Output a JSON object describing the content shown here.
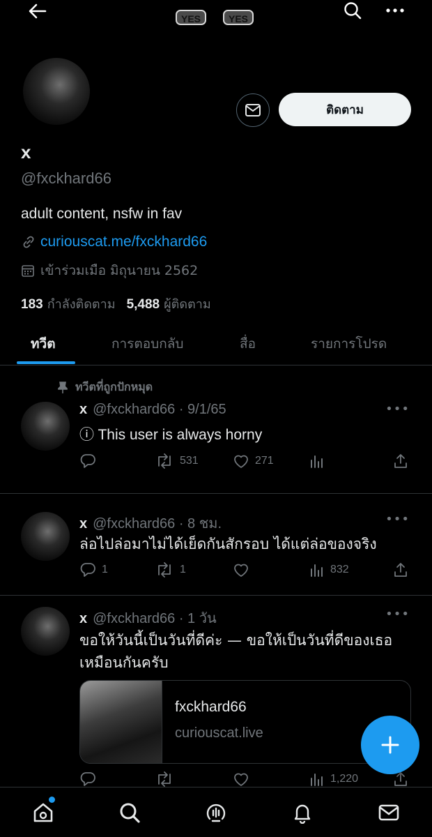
{
  "topbar": {
    "badges": [
      "YES",
      "YES"
    ]
  },
  "profile": {
    "name": "x",
    "handle": "@fxckhard66",
    "bio": "adult content, nsfw in fav",
    "link": "curiouscat.me/fxckhard66",
    "joined": "เข้าร่วมเมือ มิถุนายน 2562",
    "following_count": "183",
    "following_label": "กำลังติดตาม",
    "followers_count": "5,488",
    "followers_label": "ผู้ติดตาม",
    "follow_button": "ติดตาม"
  },
  "tabs": [
    {
      "label": "ทวีต",
      "active": true
    },
    {
      "label": "การตอบกลับ",
      "active": false
    },
    {
      "label": "สื่อ",
      "active": false
    },
    {
      "label": "รายการโปรด",
      "active": false
    }
  ],
  "pinned_label": "ทวีตที่ถูกปักหมุด",
  "tweets": [
    {
      "name": "x",
      "meta": "@fxckhard66 · 9/1/65",
      "text": "ⓘ This user is always horny",
      "replies": "",
      "retweets": "531",
      "likes": "271",
      "views": ""
    },
    {
      "name": "x",
      "meta": "@fxckhard66 · 8 ชม.",
      "text": "ล่อไปล่อมาไม่ได้เย็ดกันสักรอบ ได้แต่ล่อของจริง",
      "replies": "1",
      "retweets": "1",
      "likes": "",
      "views": "832"
    },
    {
      "name": "x",
      "meta": "@fxckhard66 · 1 วัน",
      "text": "ขอให้วันนี้เป็นวันที่ดีค่ะ — ขอให้เป็นวันที่ดีของเธอเหมือนกันครับ",
      "replies": "",
      "retweets": "",
      "likes": "",
      "views": "1,220",
      "card": {
        "title": "fxckhard66",
        "domain": "curiouscat.live"
      }
    }
  ],
  "colors": {
    "accent": "#1d9bf0",
    "muted": "#71767b",
    "text": "#e7e9ea",
    "divider": "#2f3336"
  }
}
